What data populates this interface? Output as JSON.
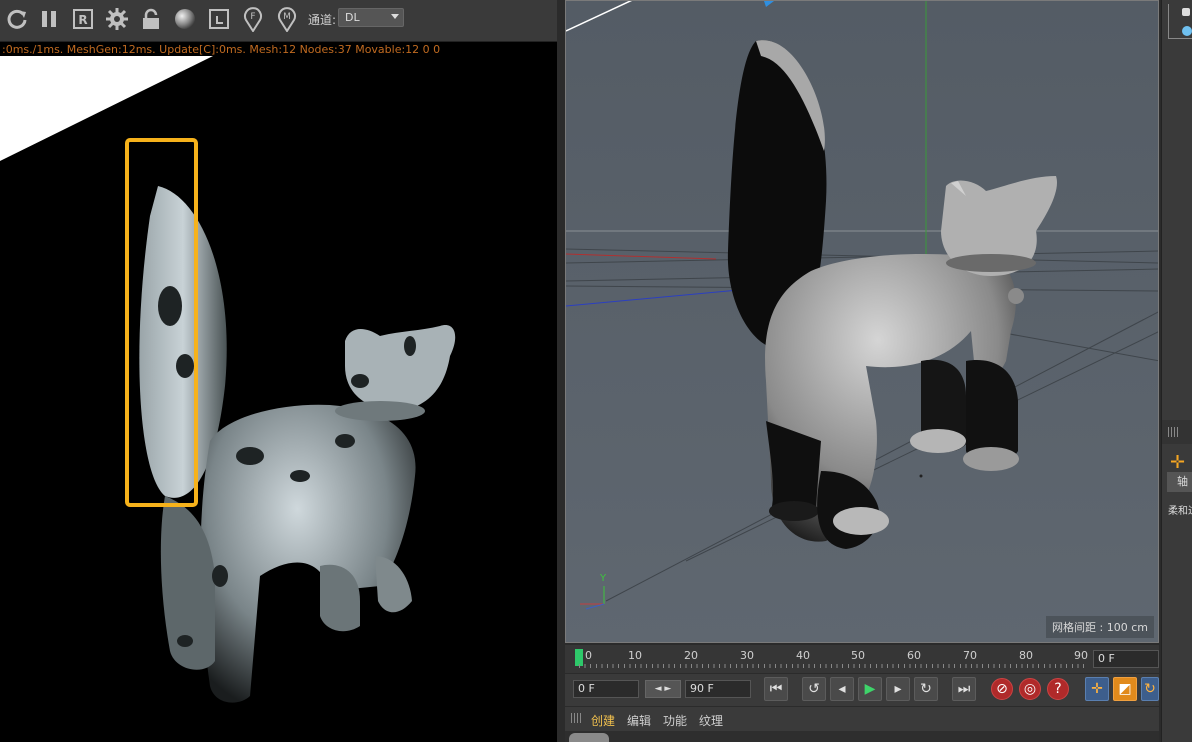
{
  "toolbar": {
    "icons": [
      "refresh-icon",
      "pause-icon",
      "region-render-icon",
      "settings-gear-icon",
      "lock-icon",
      "material-sphere-icon",
      "crop-icon",
      "f-pin-icon",
      "m-pin-icon"
    ],
    "channel_label": "通道:",
    "channel_value": "DL"
  },
  "render": {
    "stats": ":0ms./1ms. MeshGen:12ms. Update[C]:0ms. Mesh:12 Nodes:37 Movable:12  0 0",
    "highlight_color": "#f6b21b"
  },
  "viewport": {
    "grid_spacing": "网格间距 : 100 cm",
    "axis_y": "Y"
  },
  "timeline": {
    "ticks": [
      "0",
      "10",
      "20",
      "30",
      "40",
      "50",
      "60",
      "70",
      "80",
      "90"
    ],
    "current_frame": "0 F"
  },
  "transport": {
    "start_field": "0 F",
    "end_field": "90 F"
  },
  "material_manager": {
    "menu": [
      "创建",
      "编辑",
      "功能",
      "纹理"
    ]
  },
  "side_panel": {
    "tab_label": "轴",
    "section_label": "柔和过"
  }
}
